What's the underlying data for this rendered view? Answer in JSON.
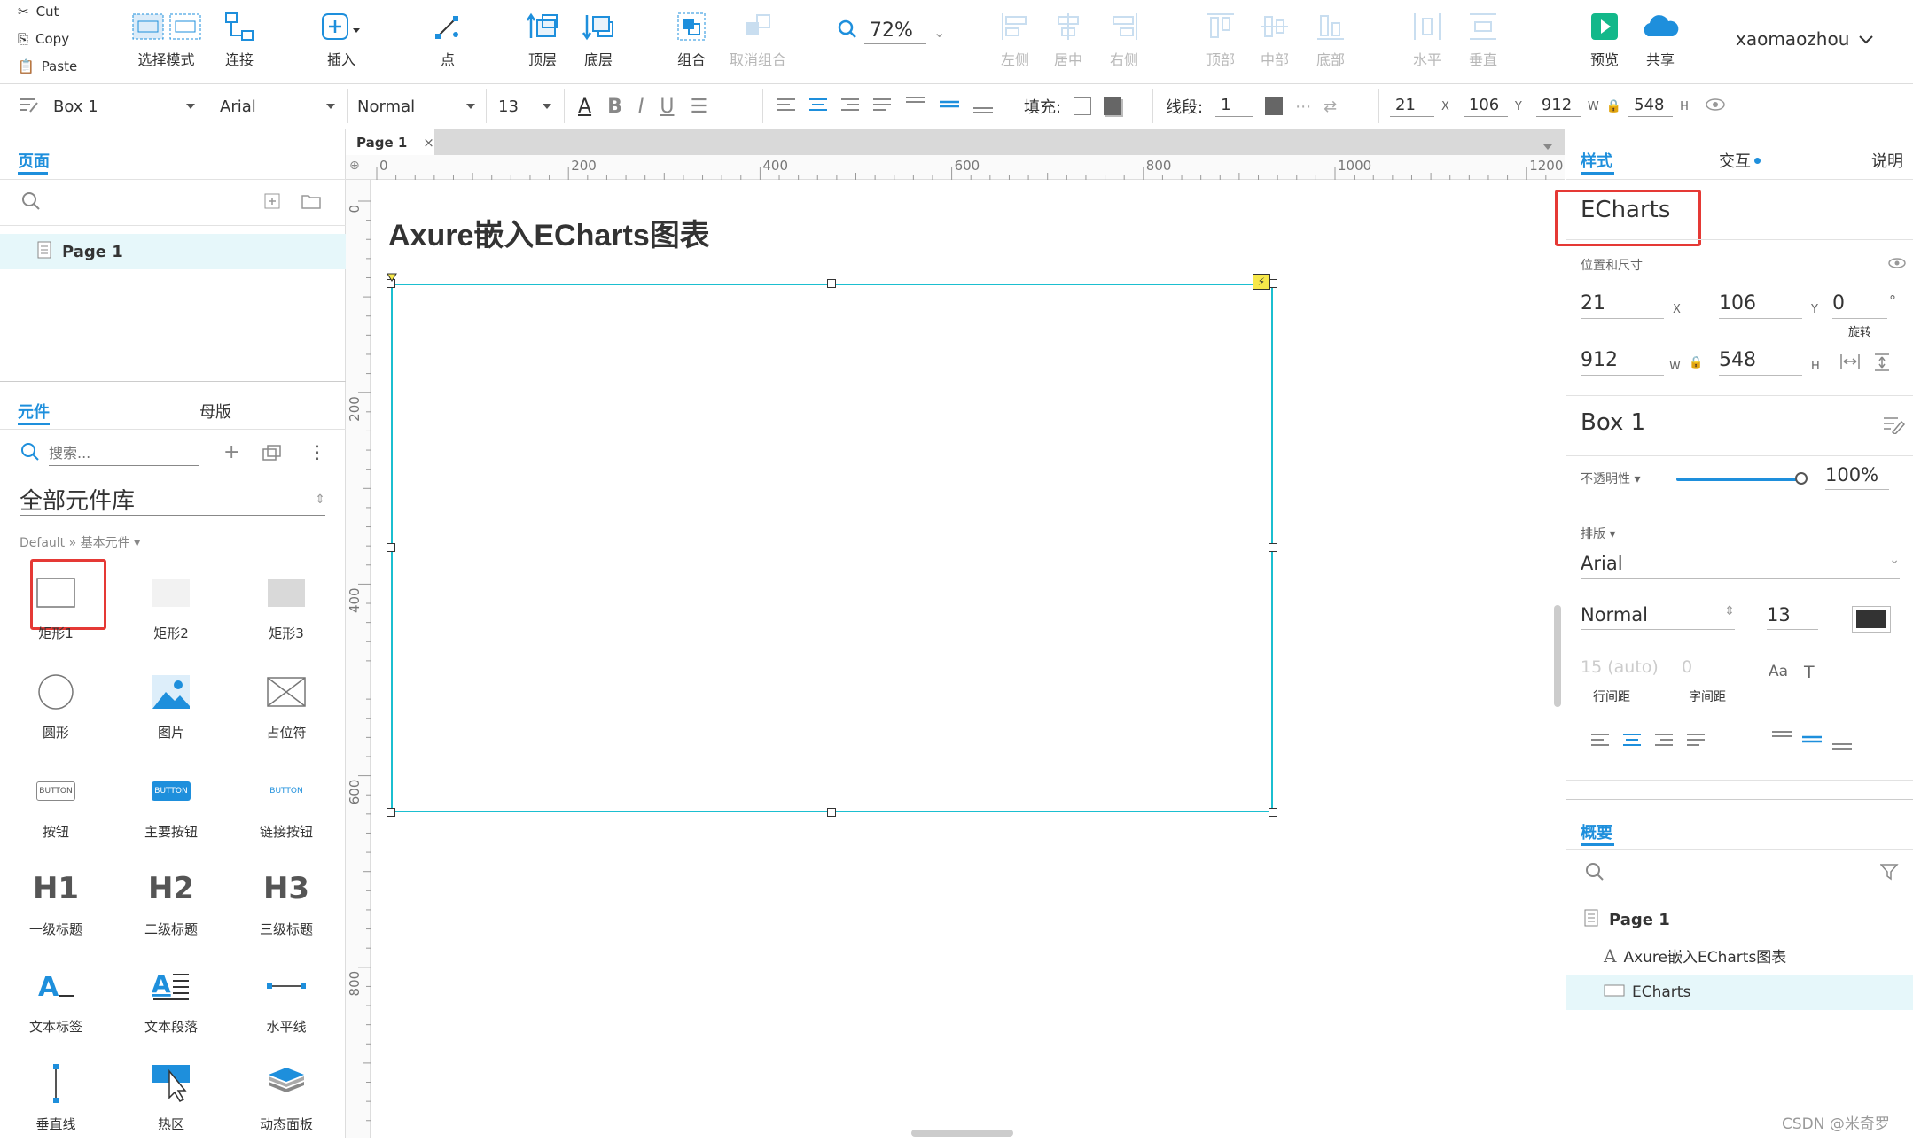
{
  "toolbar": {
    "clipboard": {
      "cut": "Cut",
      "copy": "Copy",
      "paste": "Paste"
    },
    "select_mode": "选择模式",
    "connect": "连接",
    "insert": "插入",
    "point": "点",
    "top_layer": "顶层",
    "bottom_layer": "底层",
    "group": "组合",
    "ungroup": "取消组合",
    "zoom": "72%",
    "align_left": "左侧",
    "align_center": "居中",
    "align_right": "右侧",
    "align_top": "顶部",
    "align_middle": "中部",
    "align_bottom": "底部",
    "dist_horizontal": "水平",
    "dist_vertical": "垂直",
    "preview": "预览",
    "share": "共享",
    "user": "xaomaozhou"
  },
  "formatbar": {
    "widget_name": "Box 1",
    "font": "Arial",
    "weight": "Normal",
    "size": "13",
    "fill_label": "填充:",
    "line_label": "线段:",
    "line_width": "1",
    "x": "21",
    "x_label": "X",
    "y": "106",
    "y_label": "Y",
    "w": "912",
    "w_label": "W",
    "h": "548",
    "h_label": "H"
  },
  "left": {
    "pages_tab": "页面",
    "page1": "Page 1",
    "widgets_tab": "元件",
    "masters_tab": "母版",
    "search_placeholder": "搜索...",
    "library": "全部元件库",
    "breadcrumb": "Default » 基本元件 ▾",
    "widgets": [
      "矩形1",
      "矩形2",
      "矩形3",
      "圆形",
      "图片",
      "占位符",
      "按钮",
      "主要按钮",
      "链接按钮",
      "一级标题",
      "二级标题",
      "三级标题",
      "文本标签",
      "文本段落",
      "水平线",
      "垂直线",
      "热区",
      "动态面板"
    ],
    "button_texts": [
      "BUTTON",
      "BUTTON",
      "BUTTON"
    ],
    "heading_texts": [
      "H1",
      "H2",
      "H3"
    ]
  },
  "canvas": {
    "tab": "Page 1",
    "ruler_top": [
      "0",
      "200",
      "400",
      "600",
      "800",
      "1000",
      "1200"
    ],
    "ruler_left": [
      "0",
      "200",
      "400",
      "600",
      "800"
    ],
    "heading": "Axure嵌入ECharts图表"
  },
  "right": {
    "tabs": {
      "style": "样式",
      "interaction": "交互",
      "notes": "说明"
    },
    "widget_label": "ECharts",
    "pos_size_label": "位置和尺寸",
    "x": "21",
    "x_label": "X",
    "y": "106",
    "y_label": "Y",
    "rotate": "0",
    "rotate_unit": "°",
    "rotate_label": "旋转",
    "w": "912",
    "w_label": "W",
    "h": "548",
    "h_label": "H",
    "style_name": "Box 1",
    "opacity_label": "不透明性 ▾",
    "opacity": "100%",
    "typography_label": "排版 ▾",
    "font": "Arial",
    "weight": "Normal",
    "size": "13",
    "line_height": "15 (auto)",
    "line_height_label": "行间距",
    "letter_spacing": "0",
    "letter_spacing_label": "字间距",
    "outline_tab": "概要",
    "outline_page": "Page 1",
    "outline_items": [
      "Axure嵌入ECharts图表",
      "ECharts"
    ]
  },
  "watermark": "CSDN @米奇罗",
  "colors": {
    "accent": "#1e8fdc",
    "highlight": "#e53935",
    "selection": "#1bbfd0",
    "row_highlight": "#e6f7fa"
  }
}
